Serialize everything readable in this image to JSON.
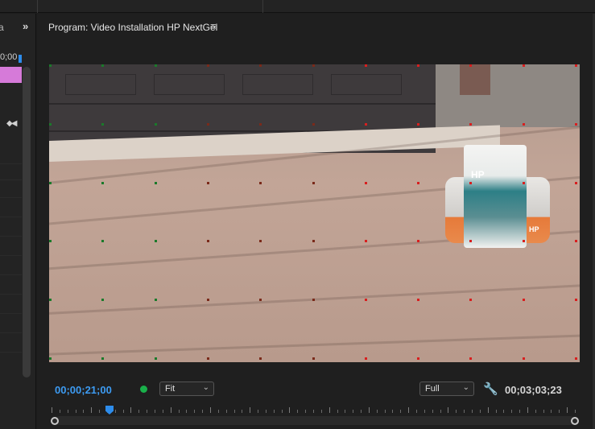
{
  "left_panel": {
    "tab_fragment": "a",
    "expand_icon": "double-chevron-right-icon",
    "timecode_fragment": "0;00",
    "keyframe_icons": "◆◀"
  },
  "program_monitor": {
    "title": "Program: Video Installation HP NextGel",
    "menu_icon": "hamburger-menu-icon"
  },
  "video_frame": {
    "bag_brand": "HP",
    "bag_small_label": "HP"
  },
  "controls": {
    "current_timecode": "00;00;21;00",
    "zoom_select": "Fit",
    "quality_select": "Full",
    "settings_icon": "wrench-icon",
    "duration_timecode": "00;03;03;23"
  },
  "colors": {
    "accent": "#2d8ceb",
    "timecode_blue": "#3d9bf2",
    "status_green": "#19b04a",
    "clip_pink": "#d67ad9"
  },
  "playhead_position": 0.11
}
